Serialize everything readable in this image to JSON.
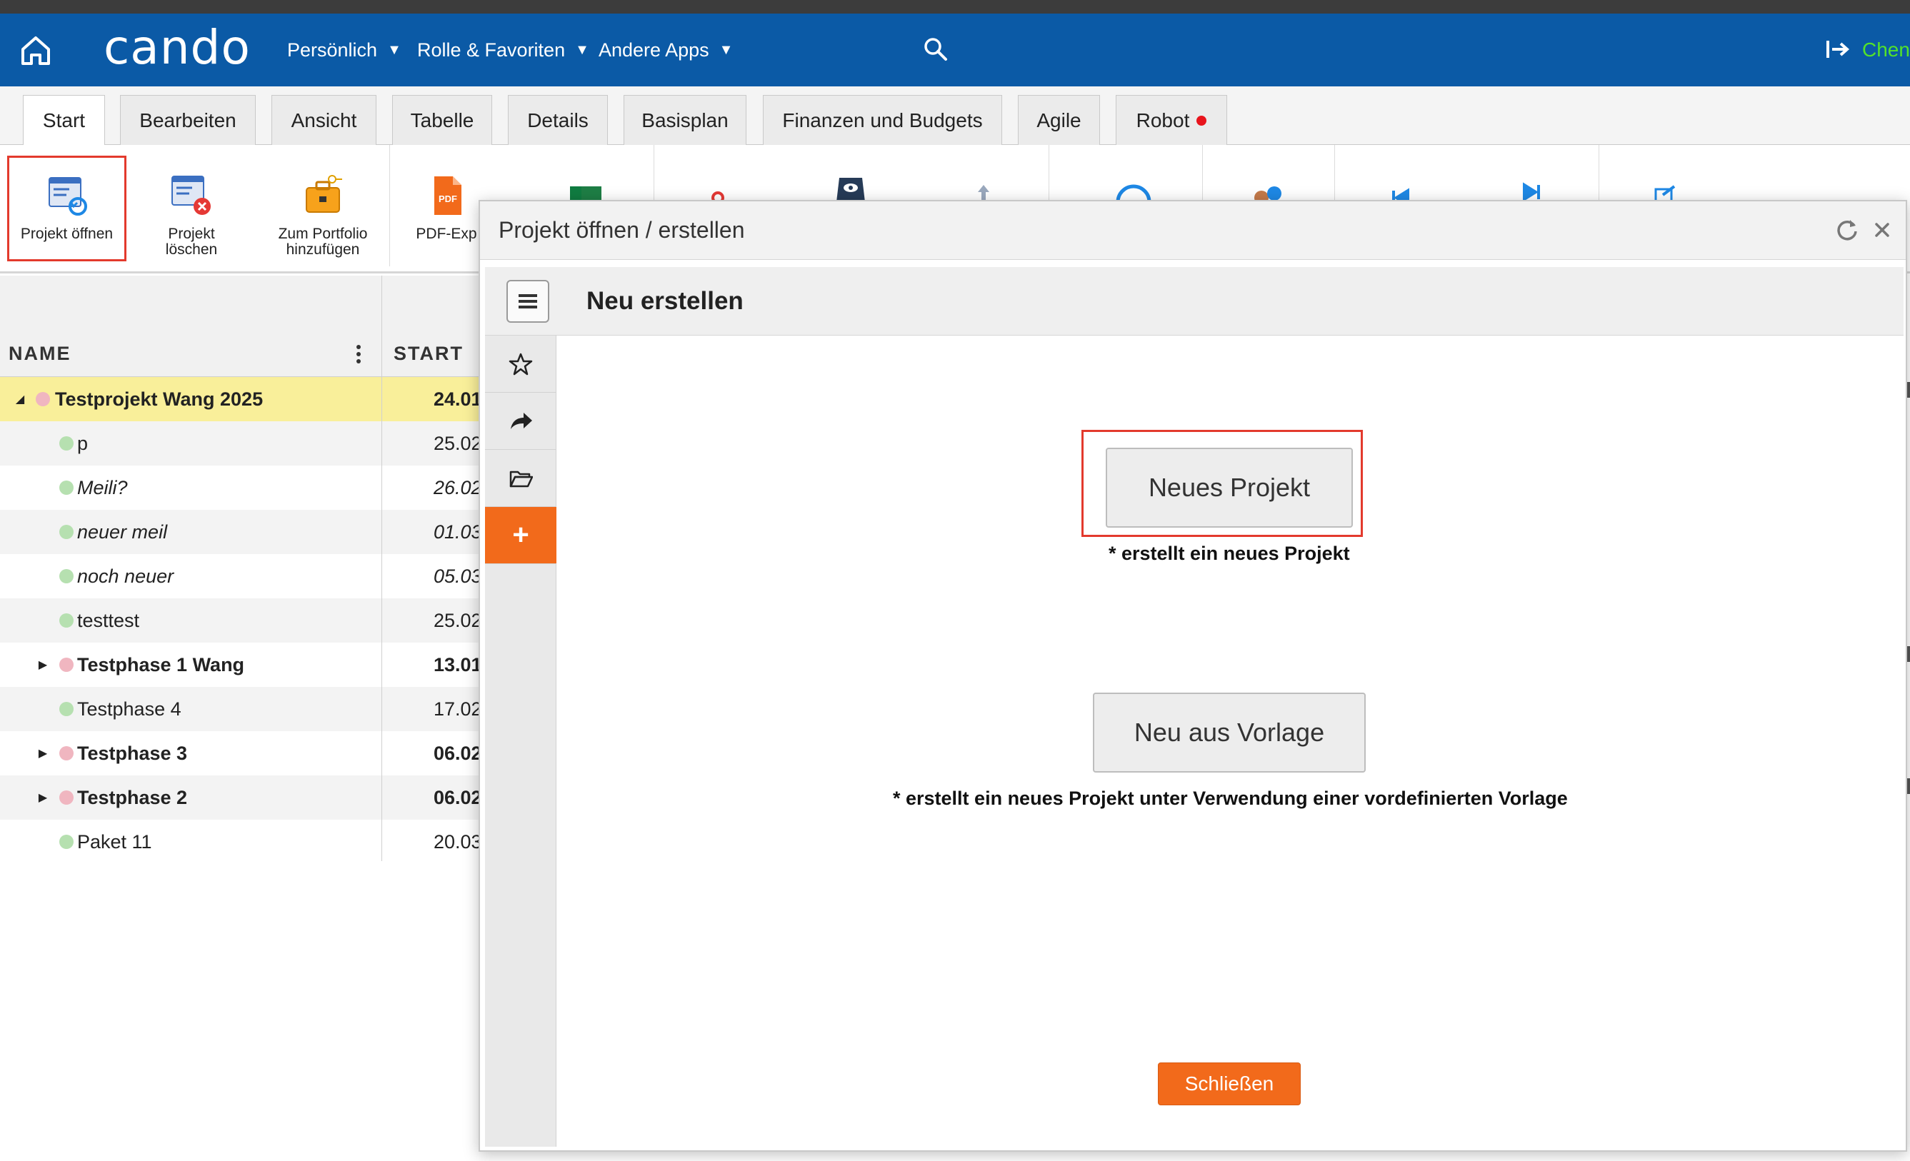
{
  "nav": {
    "logo": "cando",
    "menus": [
      {
        "label": "Persönlich"
      },
      {
        "label": "Rolle & Favoriten"
      },
      {
        "label": "Andere Apps"
      }
    ],
    "user": "Chen"
  },
  "tabs": [
    {
      "label": "Start"
    },
    {
      "label": "Bearbeiten"
    },
    {
      "label": "Ansicht"
    },
    {
      "label": "Tabelle"
    },
    {
      "label": "Details"
    },
    {
      "label": "Basisplan"
    },
    {
      "label": "Finanzen und Budgets"
    },
    {
      "label": "Agile"
    },
    {
      "label": "Robot"
    }
  ],
  "ribbon": {
    "open_project": "Projekt öffnen",
    "delete_project_1": "Projekt",
    "delete_project_2": "löschen",
    "add_portfolio_1": "Zum Portfolio",
    "add_portfolio_2": "hinzufügen",
    "pdf_export": "PDF-Exp"
  },
  "table": {
    "col_name": "NAME",
    "col_start": "START",
    "rows": [
      {
        "name": "Testprojekt Wang 2025",
        "start": "24.01"
      },
      {
        "name": "p",
        "start": "25.02"
      },
      {
        "name": "Meili?",
        "start": "26.02"
      },
      {
        "name": "neuer meil",
        "start": "01.03"
      },
      {
        "name": "noch neuer",
        "start": "05.03"
      },
      {
        "name": "testtest",
        "start": "25.02"
      },
      {
        "name": "Testphase 1 Wang",
        "start": "13.01"
      },
      {
        "name": "Testphase 4",
        "start": "17.02"
      },
      {
        "name": "Testphase 3",
        "start": "06.02"
      },
      {
        "name": "Testphase 2",
        "start": "06.02"
      },
      {
        "name": "Paket 11",
        "start": "20.03"
      }
    ]
  },
  "dialog": {
    "title": "Projekt öffnen / erstellen",
    "subheader": "Neu erstellen",
    "new_project_button": "Neues Projekt",
    "new_project_note": "* erstellt ein neues Projekt",
    "template_button": "Neu aus Vorlage",
    "template_note": "* erstellt ein neues Projekt unter Verwendung einer vordefinierten Vorlage",
    "close_button": "Schließen",
    "side_add": "+"
  },
  "colors": {
    "navbar": "#0b5aa6",
    "accent_orange": "#f26a1b",
    "highlight_red": "#e33a2d",
    "selected_row": "#f9ef9a",
    "user_green": "#53e22a"
  }
}
